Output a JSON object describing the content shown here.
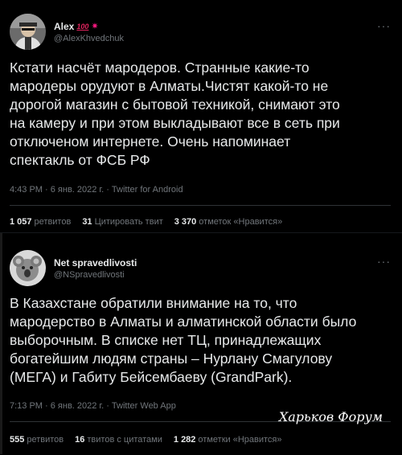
{
  "tweet1": {
    "name": "Alex",
    "name_badge": "100",
    "name_spark": "✷",
    "handle": "@AlexKhvedchuk",
    "more": "···",
    "text": "Кстати насчёт мародеров. Странные какие-то\nмародеры орудуют в Алматы.Чистят какой-то не\nдорогой магазин с бытовой техникой, снимают это\nна камеру и при этом выкладывают все в сеть при\nотключеном интернете. Очень напоминает\nспектакль от ФСБ РФ",
    "meta": "4:43 PM · 6 янв. 2022 г. · Twitter for Android",
    "retweets_count": "1 057",
    "retweets_label": "ретвитов",
    "quotes_count": "31",
    "quotes_label": "Цитировать твит",
    "likes_count": "3 370",
    "likes_label": "отметок «Нравится»"
  },
  "tweet2": {
    "name": "Net spravedlivosti",
    "handle": "@NSpravedlivosti",
    "more": "···",
    "text": "В Казахстане обратили внимание на то, что\nмародерство в Алматы и алматинской области было\nвыборочным.  В списке нет ТЦ, принадлежащих\nбогатейшим людям страны – Нурлану Смагулову\n(МЕГА) и Габиту Бейсембаеву (GrandPark).",
    "meta": "7:13 PM · 6 янв. 2022 г. · Twitter Web App",
    "retweets_count": "555",
    "retweets_label": "ретвитов",
    "quotes_count": "16",
    "quotes_label": "твитов с цитатами",
    "likes_count": "1 282",
    "likes_label": "отметки «Нравится»"
  },
  "watermark": "Харьков Форум"
}
